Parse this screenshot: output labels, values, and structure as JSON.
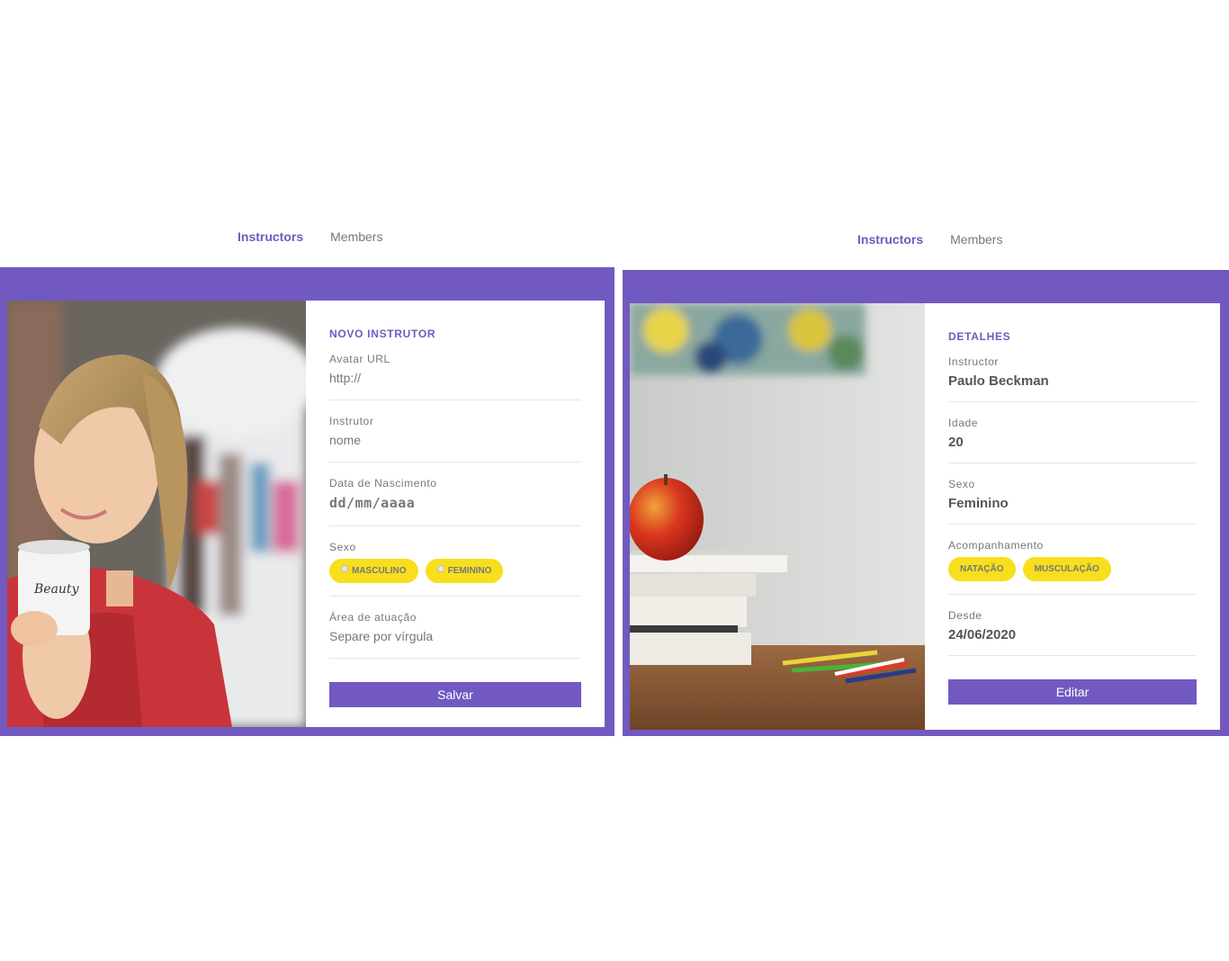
{
  "left": {
    "nav": {
      "instructors": "Instructors",
      "members": "Members"
    },
    "form": {
      "title": "Novo Instrutor",
      "avatar": {
        "label": "Avatar URL",
        "placeholder": "http://"
      },
      "instructor": {
        "label": "Instrutor",
        "placeholder": "nome"
      },
      "birth": {
        "label": "Data de Nascimento",
        "placeholder": "dd/mm/aaaa"
      },
      "gender": {
        "label": "Sexo",
        "options": [
          "Masculino",
          "Feminino"
        ]
      },
      "services": {
        "label": "Área de atuação",
        "placeholder": "Separe por vírgula"
      },
      "save_label": "Salvar"
    },
    "mug_text": "Beauty"
  },
  "right": {
    "nav": {
      "instructors": "Instructors",
      "members": "Members"
    },
    "details": {
      "title": "Detalhes",
      "instructor": {
        "label": "Instructor",
        "value": "Paulo Beckman"
      },
      "age": {
        "label": "Idade",
        "value": "20"
      },
      "gender": {
        "label": "Sexo",
        "value": "Feminino"
      },
      "services": {
        "label": "Acompanhamento",
        "tags": [
          "Natação",
          "Musculação"
        ]
      },
      "since": {
        "label": "Desde",
        "value": "24/06/2020"
      },
      "edit_label": "Editar"
    }
  },
  "colors": {
    "primary": "#7159c1",
    "accent": "#f7df1e"
  }
}
